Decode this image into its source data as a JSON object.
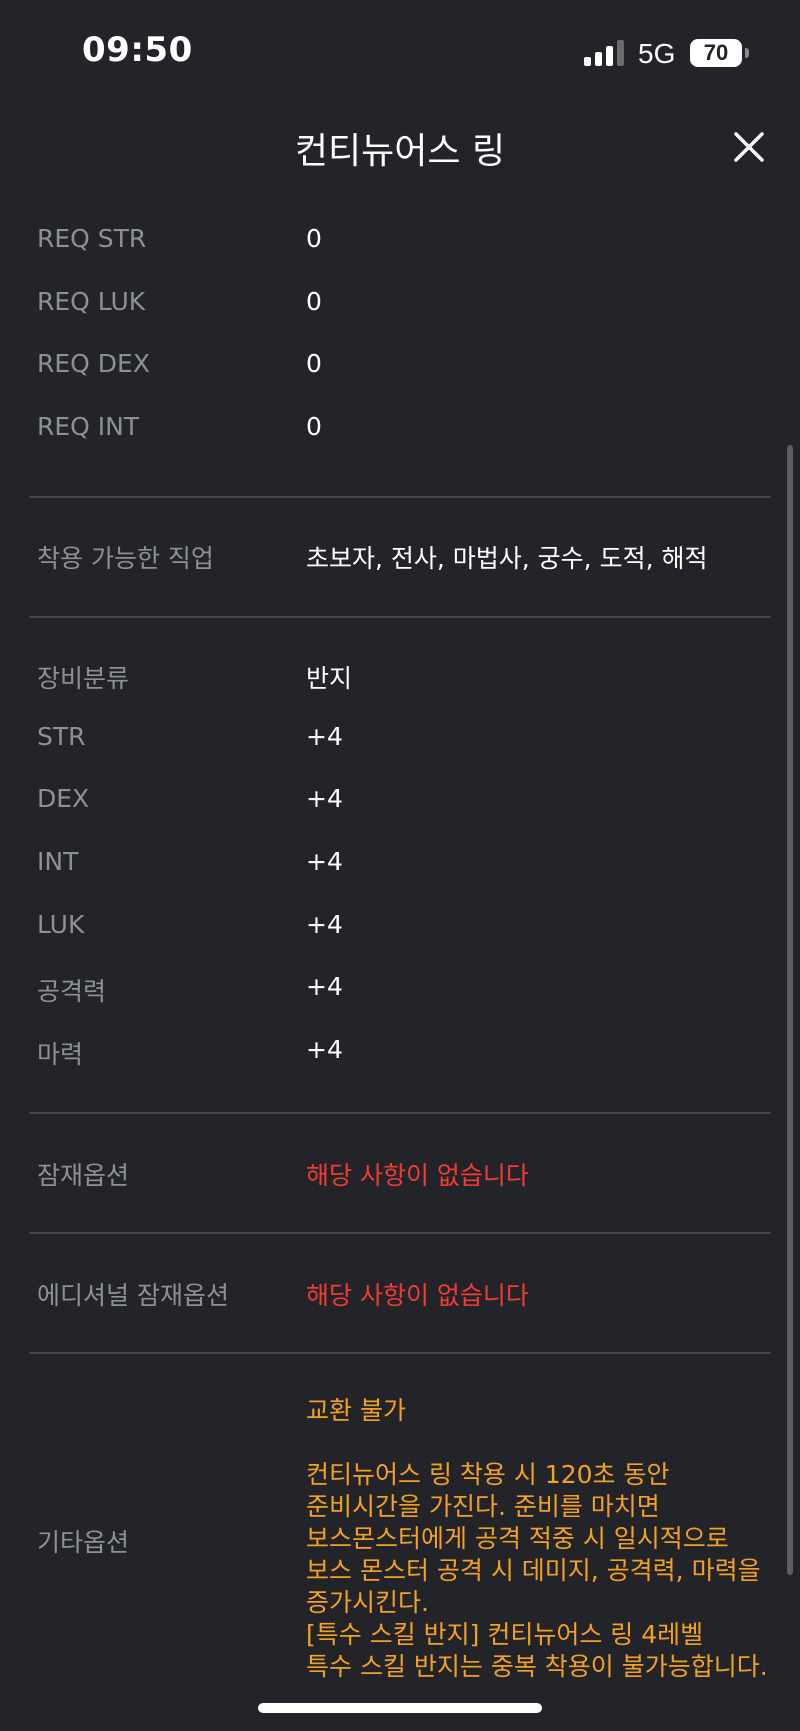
{
  "status_bar": {
    "time": "09:50",
    "network": "5G",
    "battery": "70"
  },
  "header": {
    "title": "컨티뉴어스 링"
  },
  "req_stats": [
    {
      "label": "REQ STR",
      "value": "0"
    },
    {
      "label": "REQ LUK",
      "value": "0"
    },
    {
      "label": "REQ DEX",
      "value": "0"
    },
    {
      "label": "REQ INT",
      "value": "0"
    }
  ],
  "jobs": {
    "label": "착용 가능한 직업",
    "value": "초보자, 전사, 마법사, 궁수, 도적, 해적"
  },
  "equip_stats": [
    {
      "label": "장비분류",
      "value": "반지"
    },
    {
      "label": "STR",
      "value": "+4"
    },
    {
      "label": "DEX",
      "value": "+4"
    },
    {
      "label": "INT",
      "value": "+4"
    },
    {
      "label": "LUK",
      "value": "+4"
    },
    {
      "label": "공격력",
      "value": "+4"
    },
    {
      "label": "마력",
      "value": "+4"
    }
  ],
  "potential": {
    "label": "잠재옵션",
    "value": "해당 사항이 없습니다"
  },
  "additional_potential": {
    "label": "에디셔널 잠재옵션",
    "value": "해당 사항이 없습니다"
  },
  "etc": {
    "label": "기타옵션",
    "trade": "교환 불가",
    "lines": [
      "컨티뉴어스 링 착용 시 120초 동안",
      "준비시간을 가진다. 준비를 마치면",
      "보스몬스터에게 공격 적중 시 일시적으로",
      "보스 몬스터 공격 시 데미지, 공격력, 마력을",
      "증가시킨다.",
      "[특수 스킬 반지] 컨티뉴어스 링 4레벨",
      "특수 스킬 반지는 중복 착용이 불가능합니다."
    ]
  },
  "colors": {
    "background": "#232429",
    "label": "#8e9097",
    "red": "#f03c32",
    "orange": "#f3a123"
  }
}
